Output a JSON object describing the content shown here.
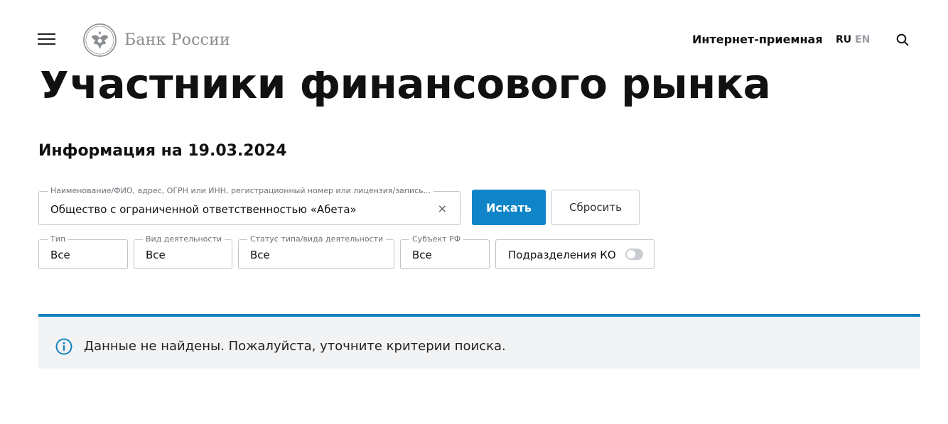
{
  "header": {
    "logo_text": "Банк России",
    "reception_link": "Интернет-приемная",
    "lang_ru": "RU",
    "lang_en": "EN",
    "icons": [
      "menu-icon",
      "bank-emblem-icon",
      "search-icon"
    ]
  },
  "page": {
    "title": "Участники финансового рынка",
    "info_date": "Информация на 19.03.2024"
  },
  "search": {
    "legend": "Наименование/ФИО, адрес, ОГРН или ИНН, регистрационный номер или лицензия/запись...",
    "value": "Общество с ограниченной ответственностью «Абета»",
    "clear_glyph": "×",
    "search_button": "Искать",
    "reset_button": "Сбросить"
  },
  "filters": {
    "type": {
      "legend": "Тип",
      "value": "Все"
    },
    "activity": {
      "legend": "Вид деятельности",
      "value": "Все"
    },
    "status": {
      "legend": "Статус типа/вида деятельности",
      "value": "Все"
    },
    "region": {
      "legend": "Субъект РФ",
      "value": "Все"
    },
    "branches": {
      "label": "Подразделения КО",
      "enabled": false
    }
  },
  "result": {
    "message": "Данные не найдены. Пожалуйста, уточните критерии поиска.",
    "icon": "info-icon"
  },
  "colors": {
    "accent": "#0f84c8",
    "notice_border": "#1282bd",
    "notice_bg": "#f2f3f4"
  }
}
